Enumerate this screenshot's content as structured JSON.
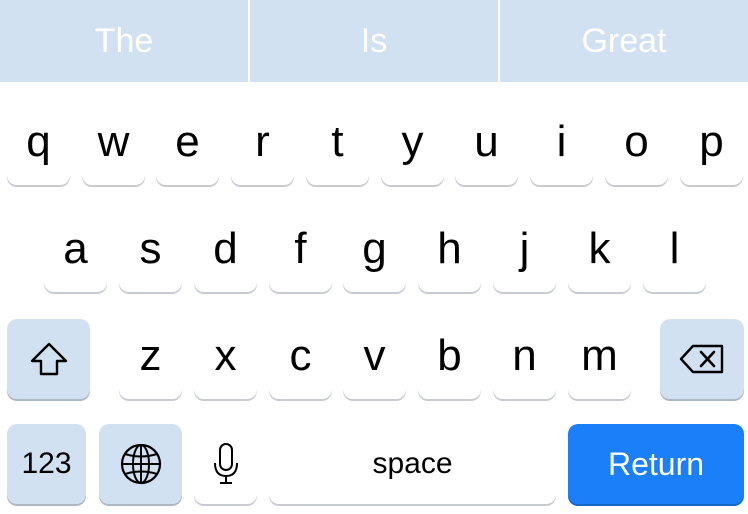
{
  "suggestions": [
    "The",
    "Is",
    "Great"
  ],
  "rows": [
    [
      "q",
      "w",
      "e",
      "r",
      "t",
      "y",
      "u",
      "i",
      "o",
      "p"
    ],
    [
      "a",
      "s",
      "d",
      "f",
      "g",
      "h",
      "j",
      "k",
      "l"
    ],
    [
      "z",
      "x",
      "c",
      "v",
      "b",
      "n",
      "m"
    ]
  ],
  "bottom_row": {
    "numbers_label": "123",
    "space_label": "space",
    "return_label": "Return"
  },
  "icons": {
    "shift": "shift-arrow-icon",
    "backspace": "backspace-icon",
    "globe": "globe-icon",
    "dictation": "microphone-icon"
  },
  "colors": {
    "suggestion_bar": "#d1e1f1",
    "special_key": "#d1e1f1",
    "return_key": "#1a7ff8",
    "letter_key": "#ffffff"
  }
}
